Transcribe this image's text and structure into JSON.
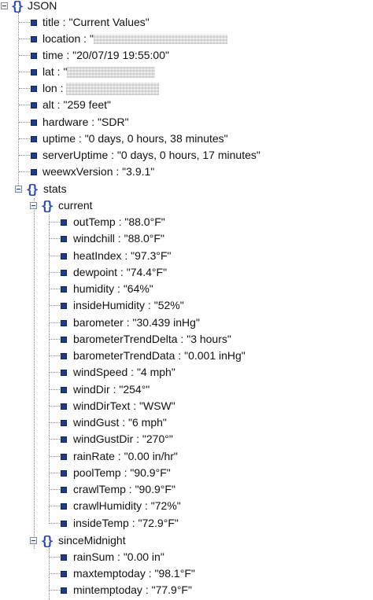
{
  "root": {
    "label": "JSON"
  },
  "top_items": [
    {
      "key": "title",
      "value": "\"Current Values\""
    },
    {
      "key": "location",
      "value": "\""
    },
    {
      "key": "time",
      "value": "\"20/07/19 19:55:00\""
    },
    {
      "key": "lat",
      "value": "\""
    },
    {
      "key": "lon",
      "value": ""
    },
    {
      "key": "alt",
      "value": "\"259 feet\""
    },
    {
      "key": "hardware",
      "value": "\"SDR\""
    },
    {
      "key": "uptime",
      "value": "\"0 days, 0 hours, 38 minutes\""
    },
    {
      "key": "serverUptime",
      "value": "\"0 days, 0 hours, 17 minutes\""
    },
    {
      "key": "weewxVersion",
      "value": "\"3.9.1\""
    }
  ],
  "stats": {
    "label": "stats",
    "current": {
      "label": "current",
      "items": [
        {
          "key": "outTemp",
          "value": "\"88.0°F\""
        },
        {
          "key": "windchill",
          "value": "\"88.0°F\""
        },
        {
          "key": "heatIndex",
          "value": "\"97.3°F\""
        },
        {
          "key": "dewpoint",
          "value": "\"74.4°F\""
        },
        {
          "key": "humidity",
          "value": "\"64%\""
        },
        {
          "key": "insideHumidity",
          "value": "\"52%\""
        },
        {
          "key": "barometer",
          "value": "\"30.439 inHg\""
        },
        {
          "key": "barometerTrendDelta",
          "value": "\"3 hours\""
        },
        {
          "key": "barometerTrendData",
          "value": "\"0.001 inHg\""
        },
        {
          "key": "windSpeed",
          "value": "\"4 mph\""
        },
        {
          "key": "windDir",
          "value": "\"254°\""
        },
        {
          "key": "windDirText",
          "value": "\"WSW\""
        },
        {
          "key": "windGust",
          "value": "\"6 mph\""
        },
        {
          "key": "windGustDir",
          "value": "\"270°\""
        },
        {
          "key": "rainRate",
          "value": "\"0.00 in/hr\""
        },
        {
          "key": "poolTemp",
          "value": "\"90.9°F\""
        },
        {
          "key": "crawlTemp",
          "value": "\"90.9°F\""
        },
        {
          "key": "crawlHumidity",
          "value": "\"72%\""
        },
        {
          "key": "insideTemp",
          "value": "\"72.9°F\""
        }
      ]
    },
    "sinceMidnight": {
      "label": "sinceMidnight",
      "items": [
        {
          "key": "rainSum",
          "value": "\"0.00 in\""
        },
        {
          "key": "maxtemptoday",
          "value": "\"98.1°F\""
        },
        {
          "key": "mintemptoday",
          "value": "\"77.9°F\""
        }
      ]
    }
  }
}
